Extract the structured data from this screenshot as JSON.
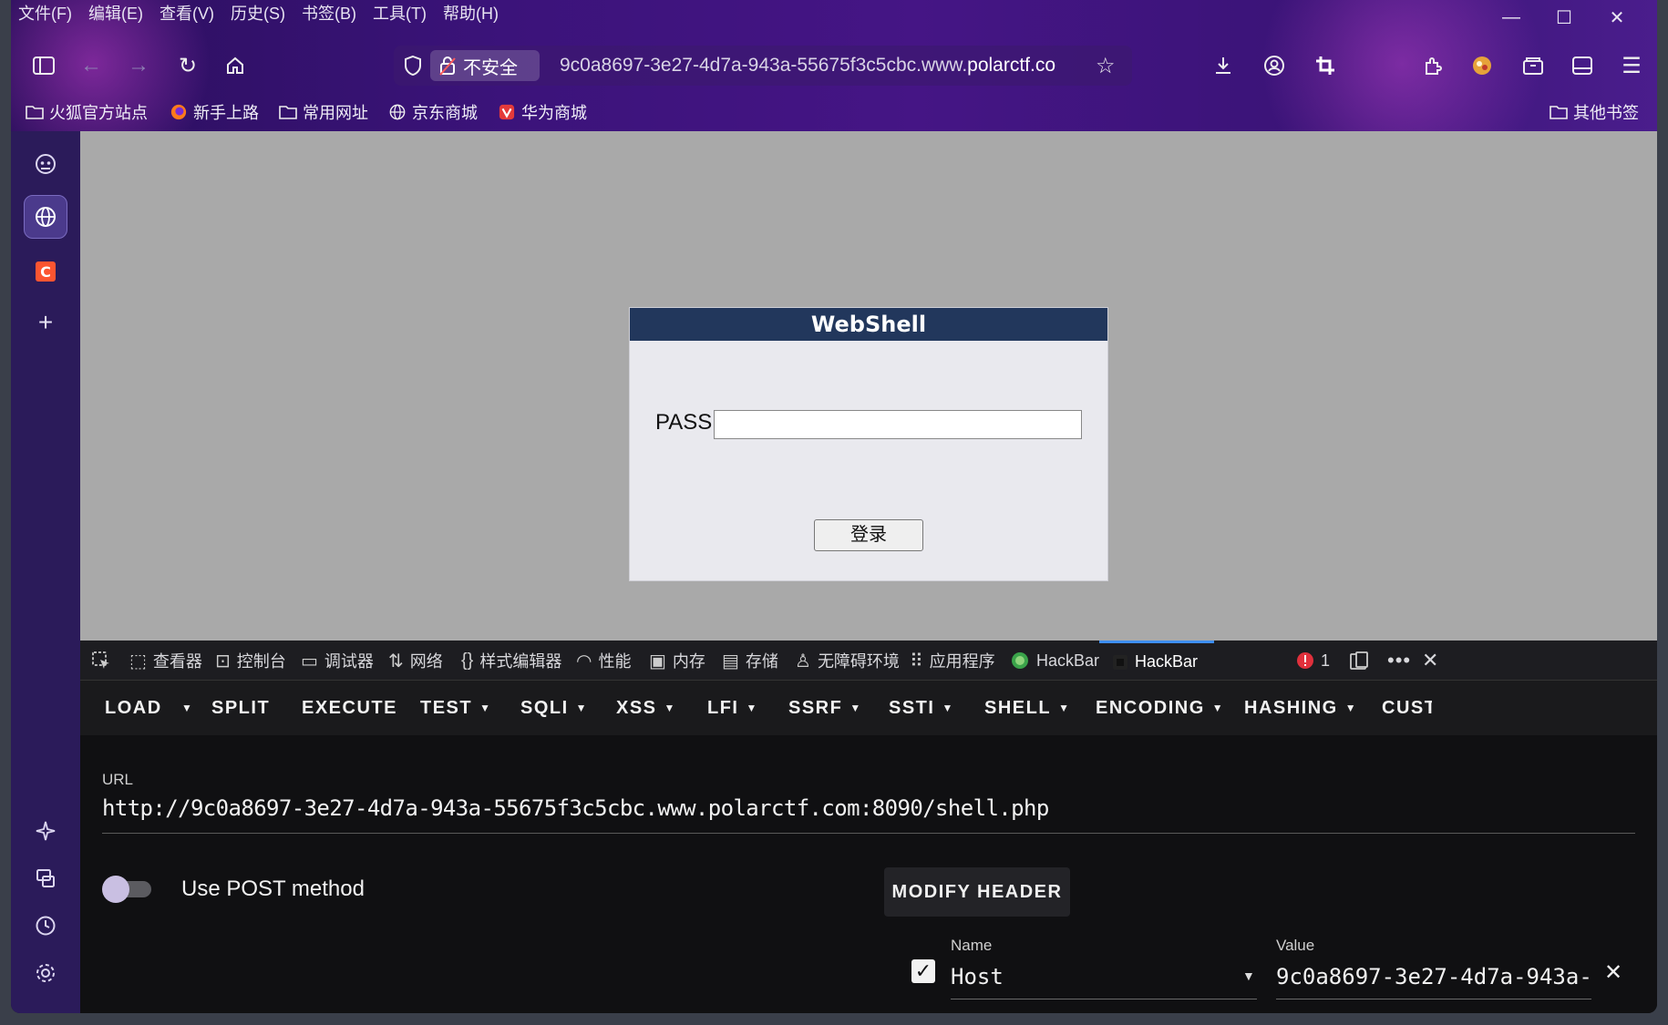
{
  "menu": [
    "文件(F)",
    "编辑(E)",
    "查看(V)",
    "历史(S)",
    "书签(B)",
    "工具(T)",
    "帮助(H)"
  ],
  "window": {
    "minimize": "—",
    "maximize": "☐",
    "close": "✕"
  },
  "nav": {
    "insecure_label": "不安全",
    "url_prefix": "9c0a8697-3e27-4d7a-943a-55675f3c5cbc.www.",
    "url_domain": "polarctf.co"
  },
  "bookmarks": [
    "火狐官方站点",
    "新手上路",
    "常用网址",
    "京东商城",
    "华为商城"
  ],
  "other_bookmarks": "其他书签",
  "page": {
    "title": "WebShell",
    "pass_label": "PASS:",
    "pass_value": "",
    "login_button": "登录"
  },
  "devtools": {
    "tabs": [
      "查看器",
      "控制台",
      "调试器",
      "网络",
      "样式编辑器",
      "性能",
      "内存",
      "存储",
      "无障碍环境",
      "应用程序",
      "HackBar",
      "HackBar"
    ],
    "error_count": "1"
  },
  "hackbar": {
    "menu": [
      "LOAD",
      "SPLIT",
      "EXECUTE",
      "TEST",
      "SQLI",
      "XSS",
      "LFI",
      "SSRF",
      "SSTI",
      "SHELL",
      "ENCODING",
      "HASHING",
      "CUSTO"
    ],
    "url_label": "URL",
    "url_value": "http://9c0a8697-3e27-4d7a-943a-55675f3c5cbc.www.polarctf.com:8090/shell.php",
    "post_label": "Use POST method",
    "post_enabled": false,
    "modify_header": "MODIFY HEADER",
    "header": {
      "name_label": "Name",
      "name_value": "Host",
      "value_label": "Value",
      "value_value": "9c0a8697-3e27-4d7a-943a-",
      "enabled": true
    }
  },
  "colors": {
    "panel_title_bg": "#22375c",
    "page_bg": "#a9a9a9",
    "devtools_bg": "#101012",
    "accent_blue": "#3d8ef0"
  }
}
